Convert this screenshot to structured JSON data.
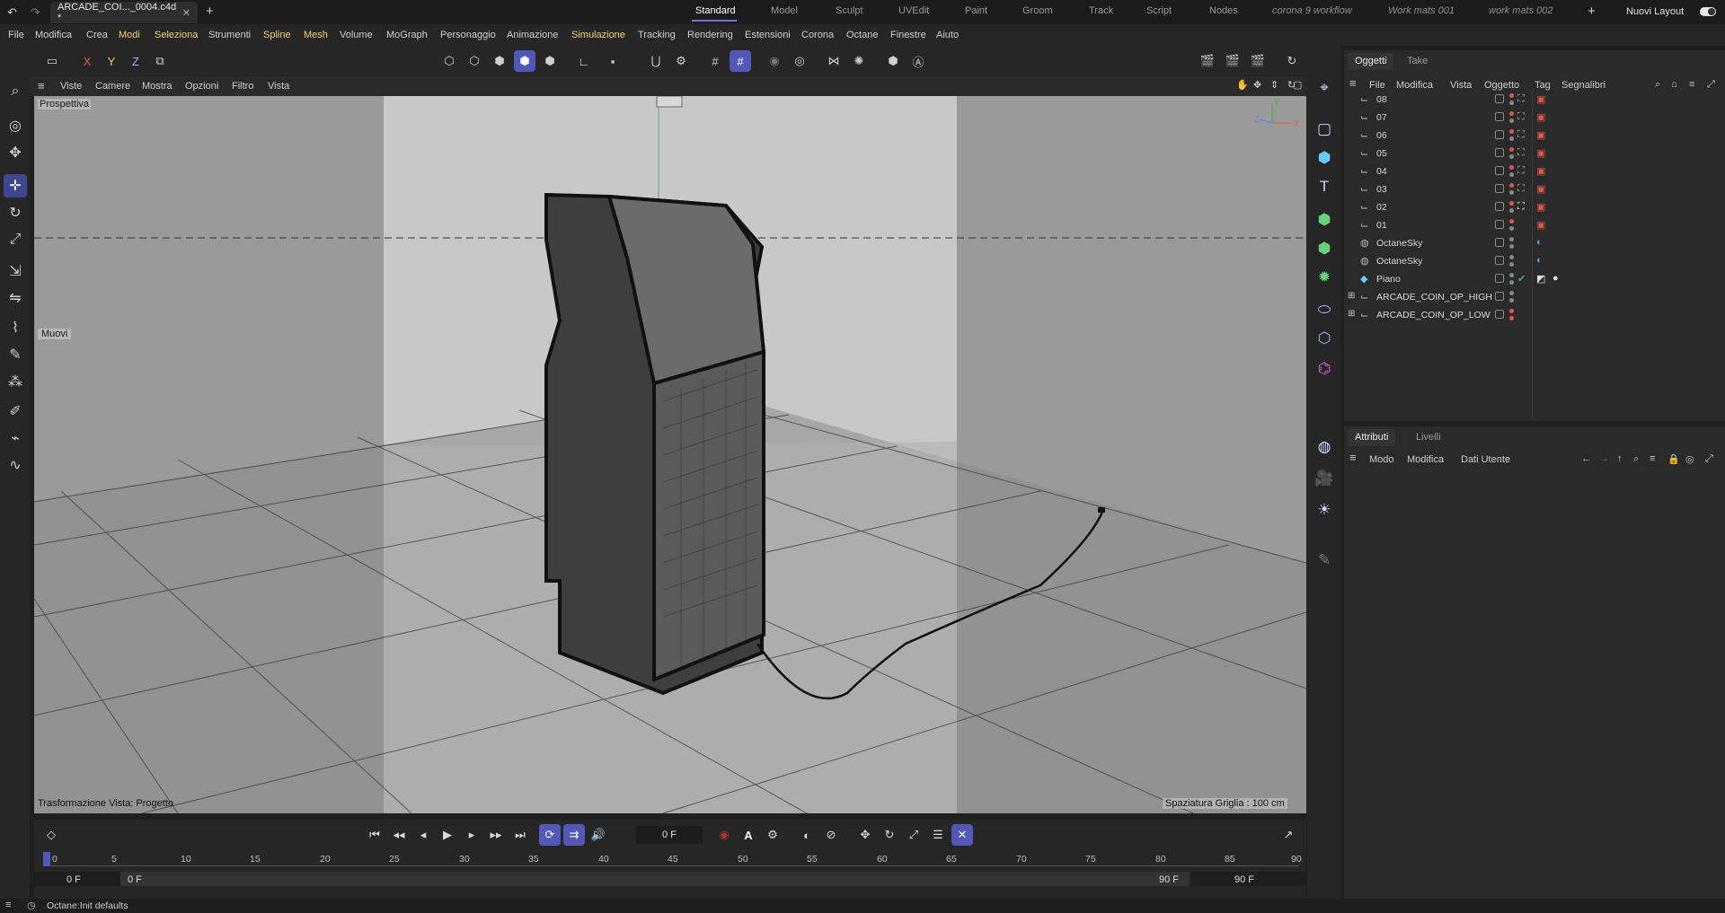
{
  "titlebar": {
    "doc_tab": "ARCADE_COI..._0004.c4d *",
    "layouts": [
      "Standard",
      "Model",
      "Sculpt",
      "UVEdit",
      "Paint",
      "Groom",
      "Track",
      "Script",
      "Nodes",
      "corona 9 workflow",
      "Work mats 001",
      "work mats 002"
    ],
    "new_layout": "Nuovi Layout"
  },
  "menubar": {
    "items": [
      "File",
      "Modifica",
      "Crea",
      "Modi",
      "Seleziona",
      "Strumenti",
      "Spline",
      "Mesh",
      "Volume",
      "MoGraph",
      "Personaggio",
      "Animazione",
      "Simulazione",
      "Tracking",
      "Rendering",
      "Estensioni",
      "Corona",
      "Octane",
      "Finestre",
      "Aiuto"
    ]
  },
  "toolbar": {
    "axis_x": "X",
    "axis_y": "Y",
    "axis_z": "Z"
  },
  "viewport": {
    "menus": [
      "Viste",
      "Camere",
      "Mostra",
      "Opzioni",
      "Filtro",
      "Vista"
    ],
    "camera_label": "Prospettiva",
    "tool_label": "Muovi",
    "bottom_left": "Trasformazione Vista: Progetto",
    "bottom_right": "Spaziatura Griglia : 100 cm",
    "axis_z": "Z",
    "axis_x": "X",
    "axis_y": "Y"
  },
  "objects_panel": {
    "tabs": [
      "Oggetti",
      "Take"
    ],
    "menus": [
      "File",
      "Modifica",
      "Vista",
      "Oggetto",
      "Tag",
      "Segnalibri"
    ],
    "rows": [
      {
        "name": "08",
        "type": "camera"
      },
      {
        "name": "07",
        "type": "camera"
      },
      {
        "name": "06",
        "type": "camera"
      },
      {
        "name": "05",
        "type": "camera"
      },
      {
        "name": "04",
        "type": "camera"
      },
      {
        "name": "03",
        "type": "camera"
      },
      {
        "name": "02",
        "type": "camera"
      },
      {
        "name": "01",
        "type": "camera"
      },
      {
        "name": "OctaneSky",
        "type": "sky"
      },
      {
        "name": "OctaneSky",
        "type": "sky"
      },
      {
        "name": "Piano",
        "type": "plane"
      },
      {
        "name": "ARCADE_COIN_OP_HIGH",
        "type": "null"
      },
      {
        "name": "ARCADE_COIN_OP_LOW",
        "type": "null"
      }
    ]
  },
  "attributes_panel": {
    "tabs": [
      "Attributi",
      "Livelli"
    ],
    "menus": [
      "Modo",
      "Modifica",
      "Dati Utente"
    ]
  },
  "timeline": {
    "current_frame": "0 F",
    "ruler": [
      "0",
      "5",
      "10",
      "15",
      "20",
      "25",
      "30",
      "35",
      "40",
      "45",
      "50",
      "55",
      "60",
      "65",
      "70",
      "75",
      "80",
      "85",
      "90"
    ],
    "range_start_a": "0 F",
    "range_start_b": "0 F",
    "range_end_a": "90 F",
    "range_end_b": "90 F",
    "autokey_label": "A"
  },
  "status": {
    "message": "Octane:Init defaults"
  },
  "colors": {
    "accent": "#5158b8",
    "menu_highlight": "#f2d16b",
    "tag_red": "#e2574c"
  }
}
